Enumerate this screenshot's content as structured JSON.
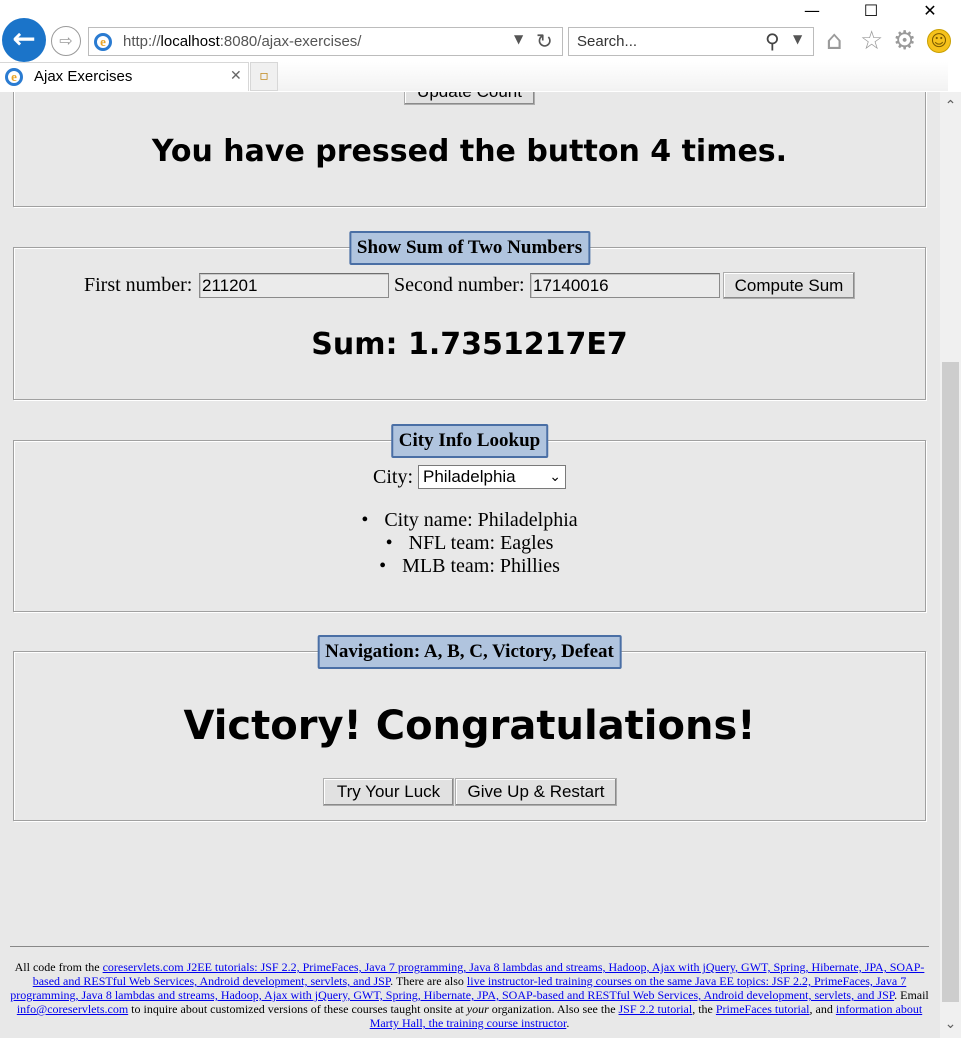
{
  "window": {
    "minimize": "—",
    "maximize": "☐",
    "close": "✕"
  },
  "browser": {
    "url_prefix": "http://",
    "url_host": "localhost",
    "url_rest": ":8080/ajax-exercises/",
    "search_placeholder": "Search...",
    "tab_title": "Ajax Exercises"
  },
  "counter": {
    "button_label": "Update Count",
    "message": "You have pressed the button 4 times."
  },
  "sum": {
    "legend": "Show Sum of Two Numbers",
    "first_label": "First number:",
    "first_value": "211201",
    "second_label": "Second number:",
    "second_value": "17140016",
    "button_label": "Compute Sum",
    "result": "Sum: 1.7351217E7"
  },
  "city": {
    "legend": "City Info Lookup",
    "label": "City:",
    "selected": "Philadelphia",
    "info": [
      "City name: Philadelphia",
      "NFL team: Eagles",
      "MLB team: Phillies"
    ]
  },
  "navigation": {
    "legend": "Navigation: A, B, C, Victory, Defeat",
    "message": "Victory! Congratulations!",
    "try_label": "Try Your Luck",
    "giveup_label": "Give Up & Restart"
  },
  "footer": {
    "t1": "All code from the ",
    "l1": "coreservlets.com J2EE tutorials: JSF 2.2, PrimeFaces, Java 7 programming, Java 8 lambdas and streams, Hadoop, Ajax with jQuery, GWT, Spring, Hibernate, JPA, SOAP-based and RESTful Web Services, Android development, servlets, and JSP",
    "t2": ". There are also ",
    "l2": "live instructor-led training courses on the same Java EE topics: JSF 2.2, PrimeFaces, Java 7 programming, Java 8 lambdas and streams, Hadoop, Ajax with jQuery, GWT, Spring, Hibernate, JPA, SOAP-based and RESTful Web Services, Android development, servlets, and JSP",
    "t3": ". Email ",
    "l3": "info@coreservlets.com",
    "t4": " to inquire about customized versions of these courses taught onsite at ",
    "t4_em": "your",
    "t5": " organization. Also see the ",
    "l4": "JSF 2.2 tutorial",
    "t6": ", the ",
    "l5": "PrimeFaces tutorial",
    "t7": ", and ",
    "l6": "information about Marty Hall, the training course instructor",
    "t8": "."
  }
}
